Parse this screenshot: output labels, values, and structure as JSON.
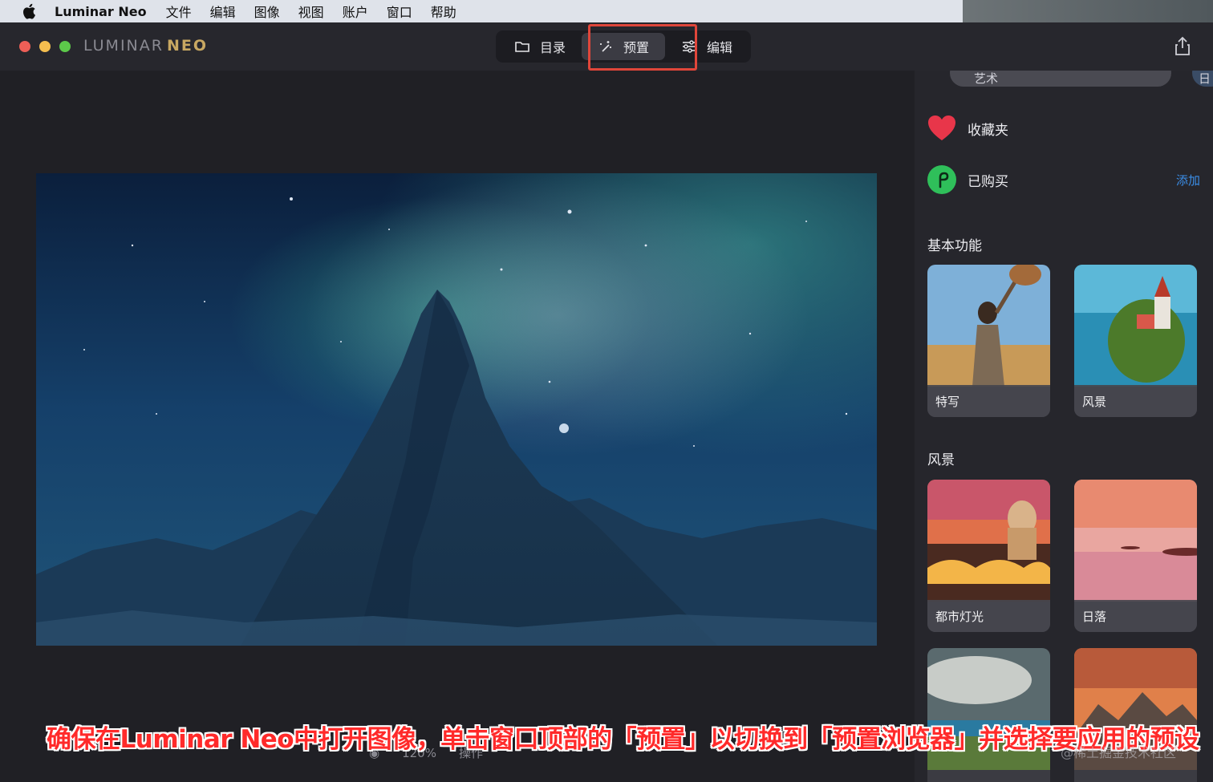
{
  "menubar": {
    "app_name": "Luminar Neo",
    "items": [
      "文件",
      "编辑",
      "图像",
      "视图",
      "账户",
      "窗口",
      "帮助"
    ]
  },
  "titlebar": {
    "logo_light": "LUMINAR",
    "logo_accent": "NEO",
    "tabs": [
      {
        "label": "目录",
        "icon": "folder-icon"
      },
      {
        "label": "预置",
        "icon": "magic-wand-icon",
        "active": true
      },
      {
        "label": "编辑",
        "icon": "sliders-icon"
      }
    ]
  },
  "panel": {
    "chips": [
      "艺术",
      "日"
    ],
    "favorites": "收藏夹",
    "purchased": "已购买",
    "add_label": "添加",
    "section_basic": "基本功能",
    "basic_cards": [
      "特写",
      "风景"
    ],
    "section_landscape": "风景",
    "landscape_cards": [
      "都市灯光",
      "日落"
    ]
  },
  "bottombar": {
    "zoom": "120%",
    "actions": "操作"
  },
  "caption": "确保在Luminar Neo中打开图像，单击窗口顶部的「预置」以切换到「预置浏览器」并选择要应用的预设",
  "watermark": "@稀土掘金技术社区",
  "colors": {
    "accent_highlight": "#e0463a",
    "link_blue": "#3b8ee8",
    "favorites_red": "#e8364a",
    "purchased_green": "#2fbf5a"
  }
}
